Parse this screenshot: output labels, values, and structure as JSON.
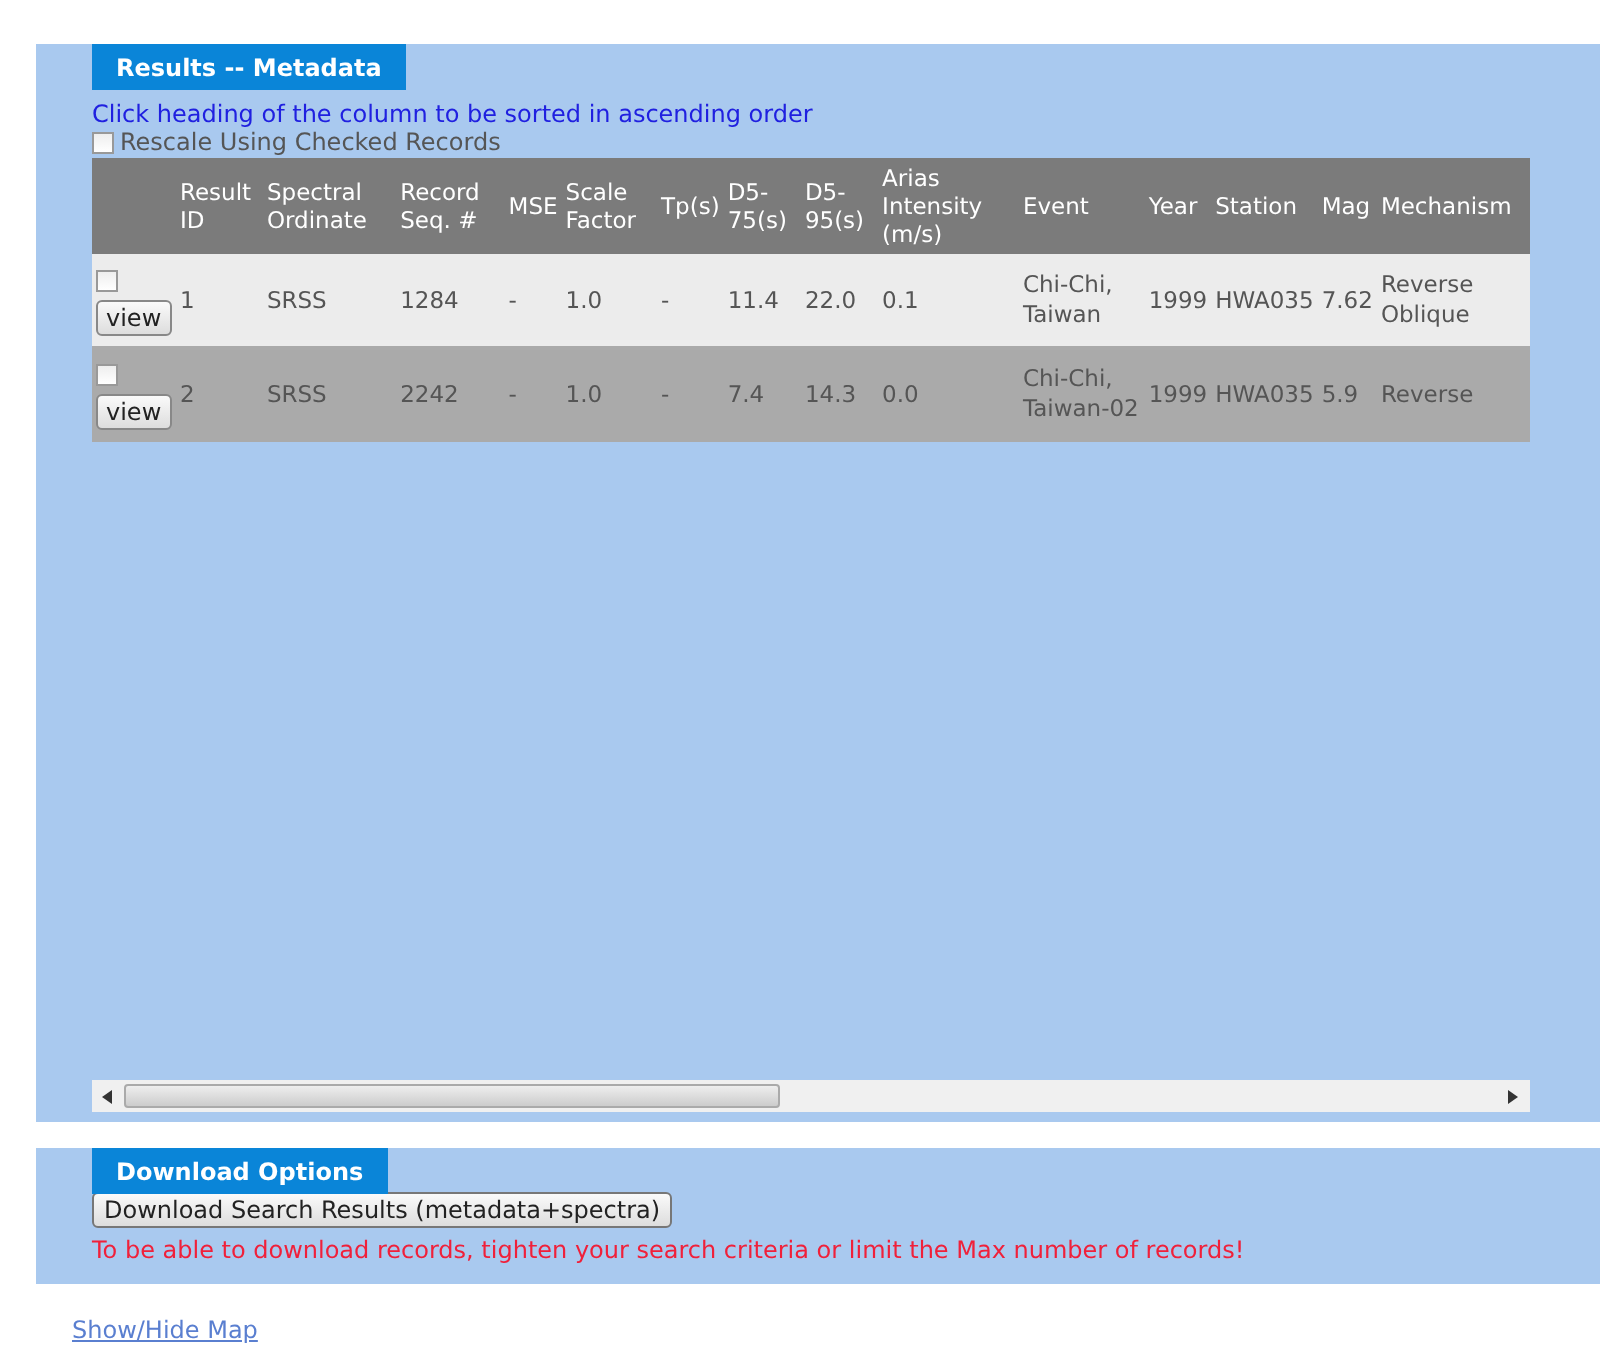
{
  "results_panel": {
    "title": "Results -- Metadata",
    "sort_hint": "Click heading of the column to be sorted in ascending order",
    "rescale": {
      "label": "Rescale Using Checked Records",
      "checked": false
    },
    "table": {
      "columns": [
        "Result ID",
        "Spectral Ordinate",
        "Record Seq. #",
        "MSE",
        "Scale Factor",
        "Tp(s)",
        "D5-75(s)",
        "D5-95(s)",
        "Arias Intensity (m/s)",
        "Event",
        "Year",
        "Station",
        "Mag",
        "Mechanism"
      ],
      "rows": [
        {
          "checked": false,
          "button": "view",
          "cells": [
            "1",
            "SRSS",
            "1284",
            "-",
            "1.0",
            "-",
            "11.4",
            "22.0",
            "0.1",
            "Chi-Chi, Taiwan",
            "1999",
            "HWA035",
            "7.62",
            "Reverse Oblique"
          ]
        },
        {
          "checked": false,
          "button": "view",
          "cells": [
            "2",
            "SRSS",
            "2242",
            "-",
            "1.0",
            "-",
            "7.4",
            "14.3",
            "0.0",
            "Chi-Chi, Taiwan-02",
            "1999",
            "HWA035",
            "5.9",
            "Reverse"
          ]
        }
      ]
    }
  },
  "download_panel": {
    "title": "Download Options",
    "button": "Download Search Results (metadata+spectra)",
    "warning": "To be able to download records, tighten your search criteria or limit the Max number of records!"
  },
  "map_link": "Show/Hide Map"
}
